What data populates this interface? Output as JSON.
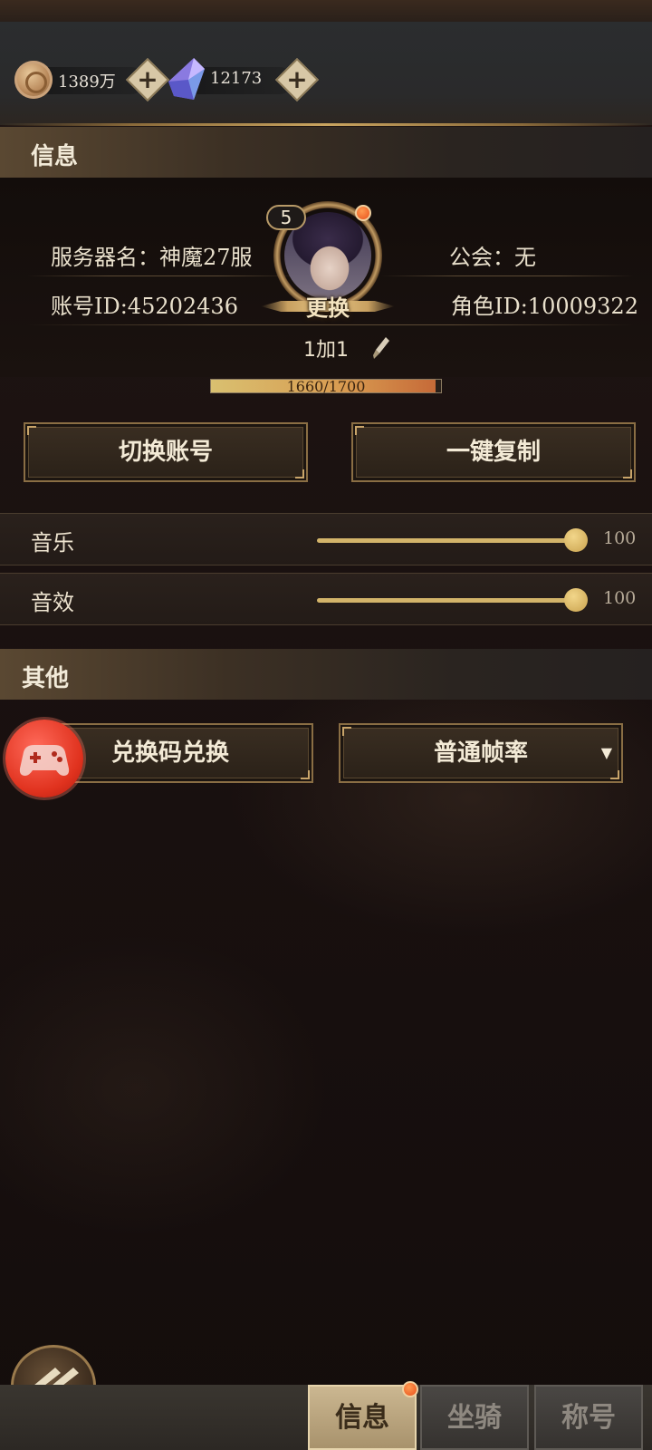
{
  "resources": {
    "coins": "1389万",
    "crystals": "12173"
  },
  "info_section": {
    "title": "信息",
    "server_name": "服务器名：神魔27服",
    "guild": "公会：无",
    "account_id": "账号ID:45202436",
    "role_id": "角色ID:10009322",
    "level": "5",
    "change_label": "更换",
    "player_name": "1加1",
    "exp_text": "1660/1700",
    "exp_fraction": 0.976,
    "switch_account_label": "切换账号",
    "copy_label": "一键复制"
  },
  "settings": {
    "music_label": "音乐",
    "music_value": "100",
    "sfx_label": "音效",
    "sfx_value": "100"
  },
  "other_section": {
    "title": "其他",
    "redeem_label": "兑换码兑换",
    "frame_rate_selected": "普通帧率"
  },
  "tabs": [
    {
      "label": "信息",
      "active": true
    },
    {
      "label": "坐骑",
      "active": false
    },
    {
      "label": "称号",
      "active": false
    }
  ],
  "colors": {
    "accent_gold": "#c9a56a",
    "notification_red": "#e8501c"
  }
}
